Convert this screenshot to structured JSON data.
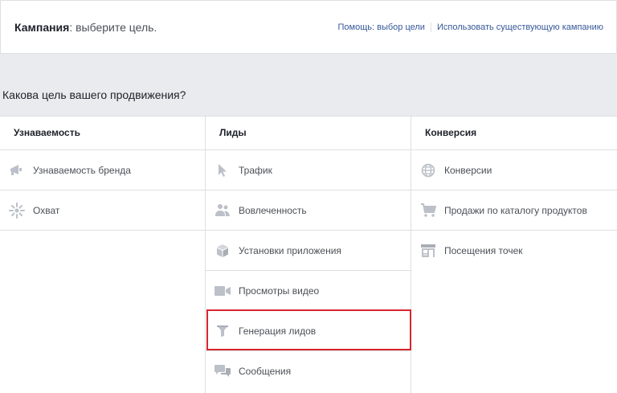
{
  "header": {
    "title_bold": "Кампания",
    "title_rest": ": выберите цель.",
    "link_help": "Помощь: выбор цели",
    "link_existing": "Использовать существующую кампанию"
  },
  "question": "Какова цель вашего продвижения?",
  "columns": [
    {
      "title": "Узнаваемость",
      "items": [
        {
          "label": "Узнаваемость бренда",
          "icon": "megaphone-icon"
        },
        {
          "label": "Охват",
          "icon": "reach-icon"
        }
      ]
    },
    {
      "title": "Лиды",
      "items": [
        {
          "label": "Трафик",
          "icon": "cursor-icon"
        },
        {
          "label": "Вовлеченность",
          "icon": "people-icon"
        },
        {
          "label": "Установки приложения",
          "icon": "box-icon"
        },
        {
          "label": "Просмотры видео",
          "icon": "video-camera-icon"
        },
        {
          "label": "Генерация лидов",
          "icon": "funnel-icon",
          "highlighted": true
        },
        {
          "label": "Сообщения",
          "icon": "chat-bubbles-icon"
        }
      ]
    },
    {
      "title": "Конверсия",
      "items": [
        {
          "label": "Конверсии",
          "icon": "globe-icon"
        },
        {
          "label": "Продажи по каталогу продуктов",
          "icon": "shopping-cart-icon"
        },
        {
          "label": "Посещения точек",
          "icon": "store-icon"
        }
      ]
    }
  ],
  "colors": {
    "link": "#365899",
    "icon": "#bcc0c8",
    "highlight": "#d8252f",
    "background": "#e9ebee"
  }
}
